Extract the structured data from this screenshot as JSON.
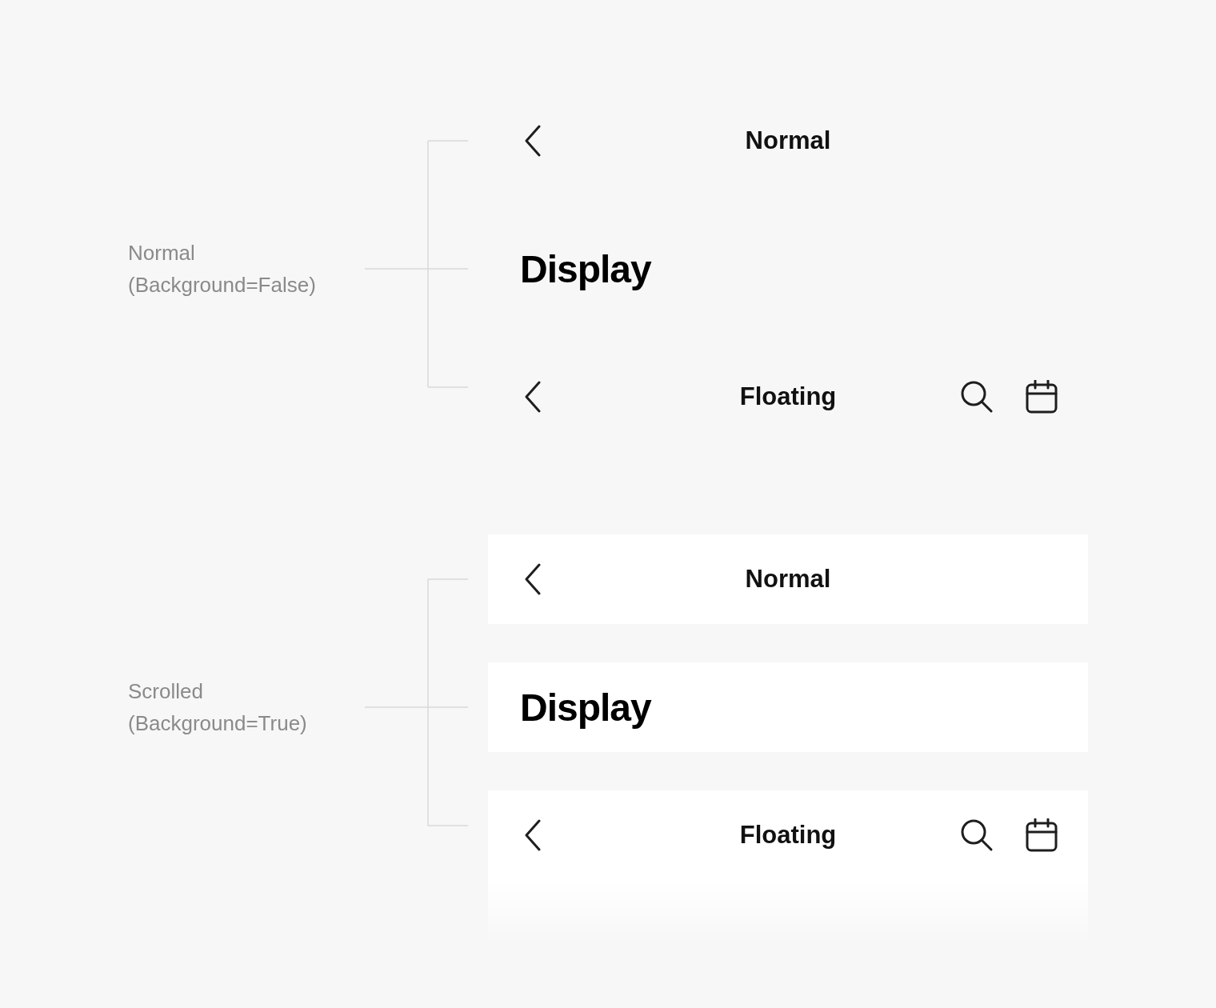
{
  "sections": [
    {
      "label_lines": [
        "Normal",
        "(Background=False)"
      ],
      "kind": "transparent",
      "bars": [
        {
          "kind": "normal",
          "back_button": true,
          "title": "Normal"
        },
        {
          "kind": "display",
          "back_button": false,
          "title": "Display"
        },
        {
          "kind": "floating",
          "back_button": true,
          "title": "Floating",
          "actions": [
            {
              "kind": "search"
            },
            {
              "kind": "calendar"
            }
          ]
        }
      ]
    },
    {
      "label_lines": [
        "Scrolled",
        "(Background=True)"
      ],
      "kind": "scrolled",
      "bars": [
        {
          "kind": "normal",
          "back_button": true,
          "title": "Normal"
        },
        {
          "kind": "display",
          "back_button": false,
          "title": "Display"
        },
        {
          "kind": "floating",
          "back_button": true,
          "title": "Floating",
          "actions": [
            {
              "kind": "search"
            },
            {
              "kind": "calendar"
            }
          ]
        }
      ]
    }
  ]
}
